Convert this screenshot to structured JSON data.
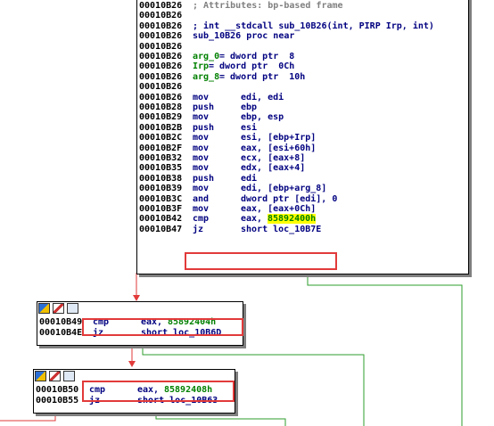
{
  "main_node": {
    "lines": [
      {
        "addr": "00010B26",
        "kind": "comment",
        "text": "; Attributes: bp-based frame"
      },
      {
        "addr": "00010B26",
        "kind": "blank",
        "text": ""
      },
      {
        "addr": "00010B26",
        "kind": "decl",
        "text": "; int __stdcall sub_10B26(int, PIRP Irp, int)"
      },
      {
        "addr": "00010B26",
        "kind": "decl",
        "text": "sub_10B26 proc near"
      },
      {
        "addr": "00010B26",
        "kind": "blank",
        "text": ""
      },
      {
        "addr": "00010B26",
        "kind": "arg",
        "name": "arg_0",
        "def": "= dword ptr  8"
      },
      {
        "addr": "00010B26",
        "kind": "arg",
        "name": "Irp",
        "def": "= dword ptr  0Ch"
      },
      {
        "addr": "00010B26",
        "kind": "arg",
        "name": "arg_8",
        "def": "= dword ptr  10h"
      },
      {
        "addr": "00010B26",
        "kind": "blank",
        "text": ""
      },
      {
        "addr": "00010B26",
        "kind": "ins",
        "mn": "mov",
        "ops": "edi, edi"
      },
      {
        "addr": "00010B28",
        "kind": "ins",
        "mn": "push",
        "ops": "ebp"
      },
      {
        "addr": "00010B29",
        "kind": "ins",
        "mn": "mov",
        "ops": "ebp, esp"
      },
      {
        "addr": "00010B2B",
        "kind": "ins",
        "mn": "push",
        "ops": "esi"
      },
      {
        "addr": "00010B2C",
        "kind": "ins",
        "mn": "mov",
        "ops": "esi, [ebp+Irp]"
      },
      {
        "addr": "00010B2F",
        "kind": "ins",
        "mn": "mov",
        "ops": "eax, [esi+60h]"
      },
      {
        "addr": "00010B32",
        "kind": "ins",
        "mn": "mov",
        "ops": "ecx, [eax+8]"
      },
      {
        "addr": "00010B35",
        "kind": "ins",
        "mn": "mov",
        "ops": "edx, [eax+4]"
      },
      {
        "addr": "00010B38",
        "kind": "ins",
        "mn": "push",
        "ops": "edi"
      },
      {
        "addr": "00010B39",
        "kind": "ins",
        "mn": "mov",
        "ops": "edi, [ebp+arg_8]"
      },
      {
        "addr": "00010B3C",
        "kind": "ins",
        "mn": "and",
        "ops": "dword ptr [edi], 0"
      },
      {
        "addr": "00010B3F",
        "kind": "ins",
        "mn": "mov",
        "ops": "eax, [eax+0Ch]"
      },
      {
        "addr": "00010B42",
        "kind": "ins",
        "mn": "cmp",
        "ops": "eax, ",
        "imm": "85892400h",
        "highlight": true
      },
      {
        "addr": "00010B47",
        "kind": "ins",
        "mn": "jz",
        "ops": "short loc_10B7E"
      }
    ]
  },
  "node2": {
    "icons": [
      "graph-icon",
      "edit-icon",
      "comment-icon"
    ],
    "lines": [
      {
        "addr": "00010B49",
        "mn": "cmp",
        "ops": "eax, ",
        "imm": "85892404h"
      },
      {
        "addr": "00010B4E",
        "mn": "jz",
        "ops": "short loc_10B6D"
      }
    ]
  },
  "node3": {
    "icons": [
      "graph-icon",
      "edit-icon",
      "comment-icon"
    ],
    "lines": [
      {
        "addr": "00010B50",
        "mn": "cmp",
        "ops": "eax, ",
        "imm": "85892408h"
      },
      {
        "addr": "00010B55",
        "mn": "jz",
        "ops": "short loc_10B63"
      }
    ]
  },
  "colors": {
    "address": "#000000",
    "mnemonic": "#000080",
    "immediate": "#008000",
    "comment": "#808080",
    "highlight": "#ffff00",
    "annotation_box": "#e23a3a",
    "edge_true": "#2e9e2e",
    "edge_false": "#e23a3a"
  }
}
